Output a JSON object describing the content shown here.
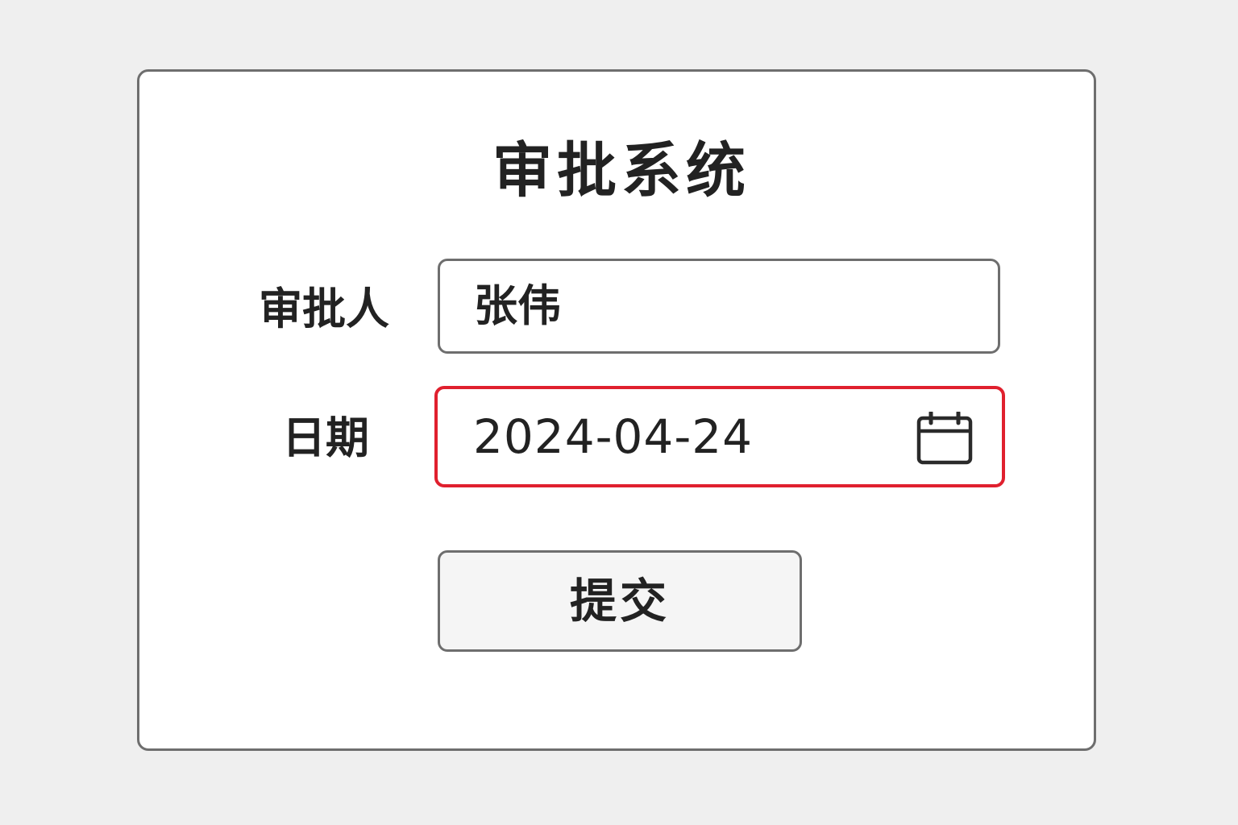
{
  "form": {
    "title": "审批系统",
    "approver": {
      "label": "审批人",
      "value": "张伟"
    },
    "date": {
      "label": "日期",
      "value": "2024-04-24",
      "icon": "calendar-icon",
      "border_color": "#e0202e"
    },
    "submit_label": "提交"
  },
  "colors": {
    "background": "#efefef",
    "card": "#ffffff",
    "border": "#6e6e6e",
    "error": "#e0202e",
    "text": "#222222"
  }
}
